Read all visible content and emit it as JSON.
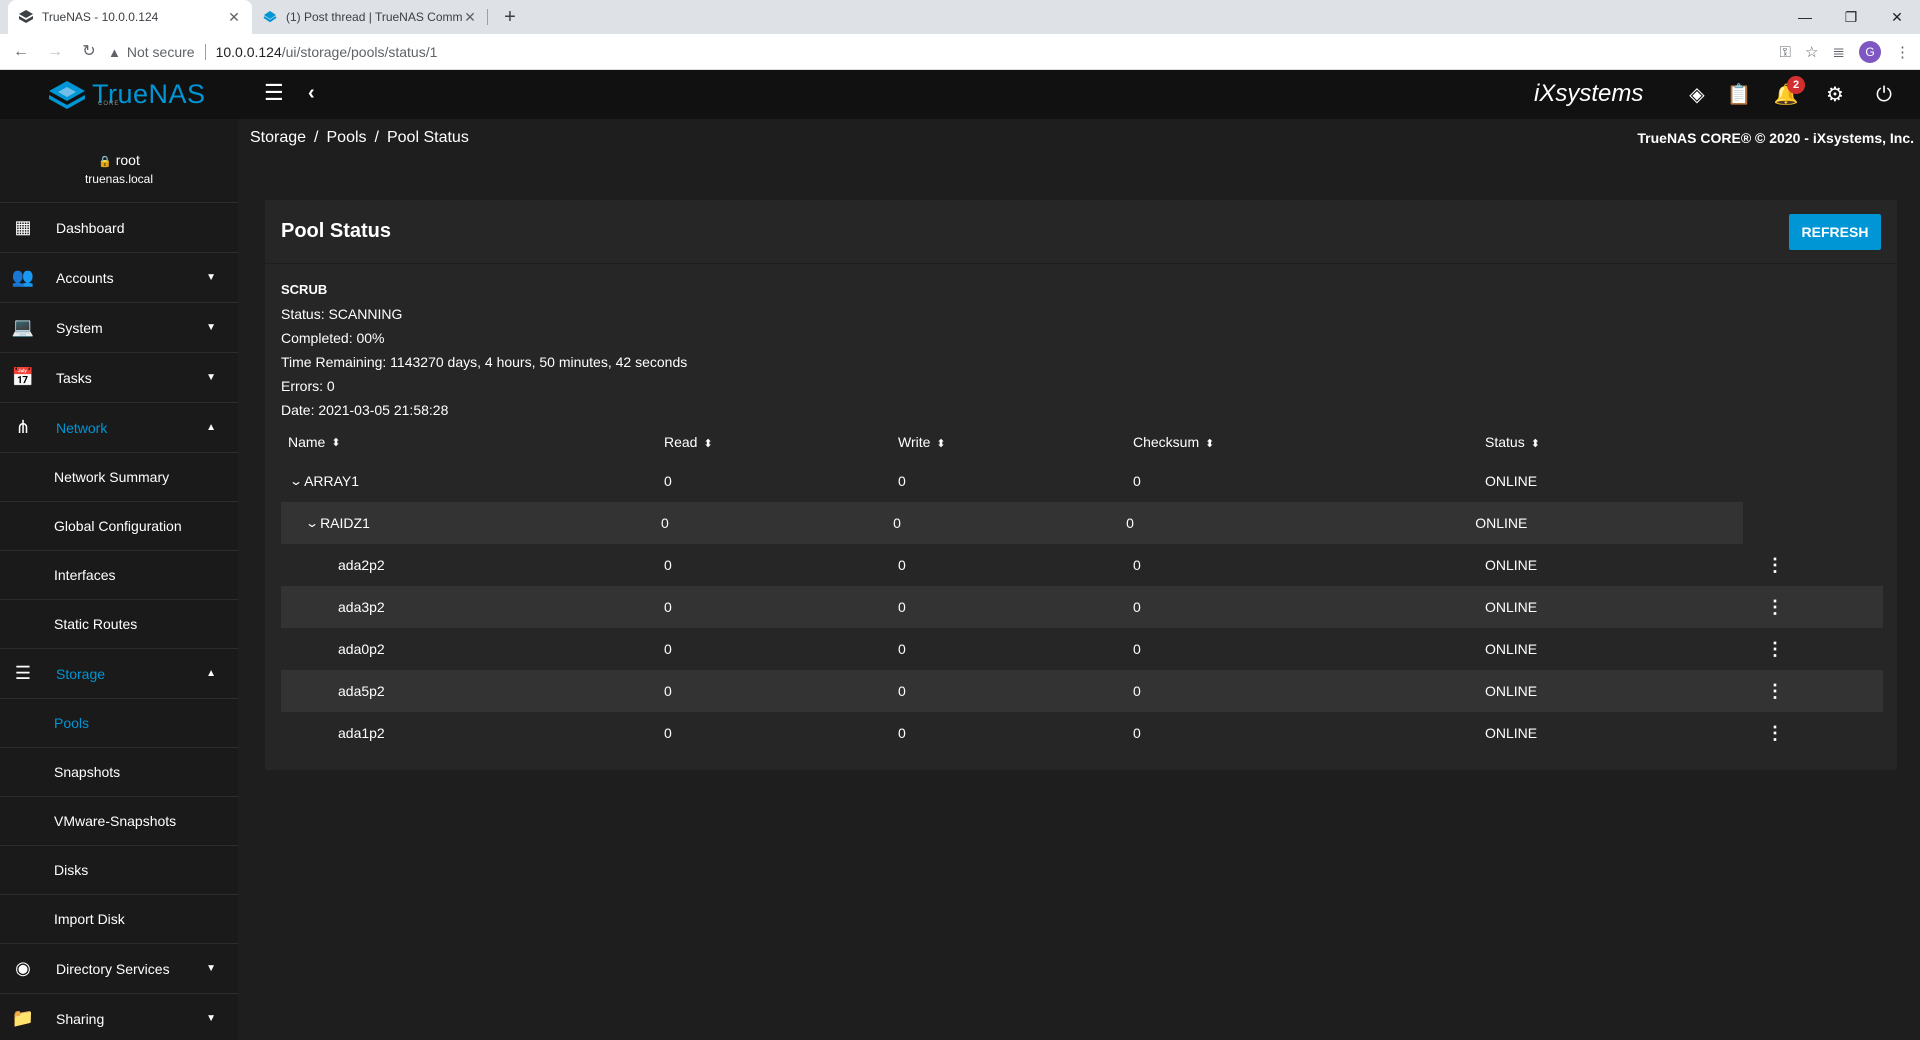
{
  "browser": {
    "tabs": [
      {
        "title": "TrueNAS - 10.0.0.124",
        "active": true
      },
      {
        "title": "(1) Post thread | TrueNAS Comm",
        "active": false
      }
    ],
    "security_label": "Not secure",
    "url_host": "10.0.0.124",
    "url_path": "/ui/storage/pools/status/1",
    "profile_initial": "G"
  },
  "topbar": {
    "brand": "TrueNAS",
    "brand_sub": "CORE",
    "vendor_logo": "iXsystems",
    "notification_count": "2"
  },
  "sidebar": {
    "user": "root",
    "host": "truenas.local",
    "items": [
      {
        "label": "Dashboard",
        "icon": "dashboard-icon"
      },
      {
        "label": "Accounts",
        "icon": "people-icon"
      },
      {
        "label": "System",
        "icon": "laptop-icon"
      },
      {
        "label": "Tasks",
        "icon": "calendar-icon"
      },
      {
        "label": "Network",
        "icon": "network-icon"
      },
      {
        "label": "Storage",
        "icon": "storage-icon"
      },
      {
        "label": "Directory Services",
        "icon": "directory-icon"
      },
      {
        "label": "Sharing",
        "icon": "sharing-icon"
      }
    ],
    "network_sub": [
      "Network Summary",
      "Global Configuration",
      "Interfaces",
      "Static Routes"
    ],
    "storage_sub": [
      "Pools",
      "Snapshots",
      "VMware-Snapshots",
      "Disks",
      "Import Disk"
    ]
  },
  "breadcrumb": [
    "Storage",
    "Pools",
    "Pool Status"
  ],
  "copyright": "TrueNAS CORE® © 2020 - iXsystems, Inc.",
  "card": {
    "title": "Pool Status",
    "refresh_label": "REFRESH"
  },
  "scrub": {
    "heading": "SCRUB",
    "status": "Status: SCANNING",
    "completed": "Completed: 00%",
    "remaining": "Time Remaining: 1143270 days, 4 hours, 50 minutes, 42 seconds",
    "errors": "Errors: 0",
    "date": "Date: 2021-03-05 21:58:28"
  },
  "table": {
    "columns": [
      "Name",
      "Read",
      "Write",
      "Checksum",
      "Status"
    ],
    "rows": [
      {
        "name": "ARRAY1",
        "read": "0",
        "write": "0",
        "checksum": "0",
        "status": "ONLINE"
      },
      {
        "name": "RAIDZ1",
        "read": "0",
        "write": "0",
        "checksum": "0",
        "status": "ONLINE"
      },
      {
        "name": "ada2p2",
        "read": "0",
        "write": "0",
        "checksum": "0",
        "status": "ONLINE"
      },
      {
        "name": "ada3p2",
        "read": "0",
        "write": "0",
        "checksum": "0",
        "status": "ONLINE"
      },
      {
        "name": "ada0p2",
        "read": "0",
        "write": "0",
        "checksum": "0",
        "status": "ONLINE"
      },
      {
        "name": "ada5p2",
        "read": "0",
        "write": "0",
        "checksum": "0",
        "status": "ONLINE"
      },
      {
        "name": "ada1p2",
        "read": "0",
        "write": "0",
        "checksum": "0",
        "status": "ONLINE"
      }
    ]
  },
  "colors": {
    "accent": "#0095d5",
    "topbar": "#111111",
    "sidebar": "#1a1a1a",
    "card": "#262626"
  }
}
